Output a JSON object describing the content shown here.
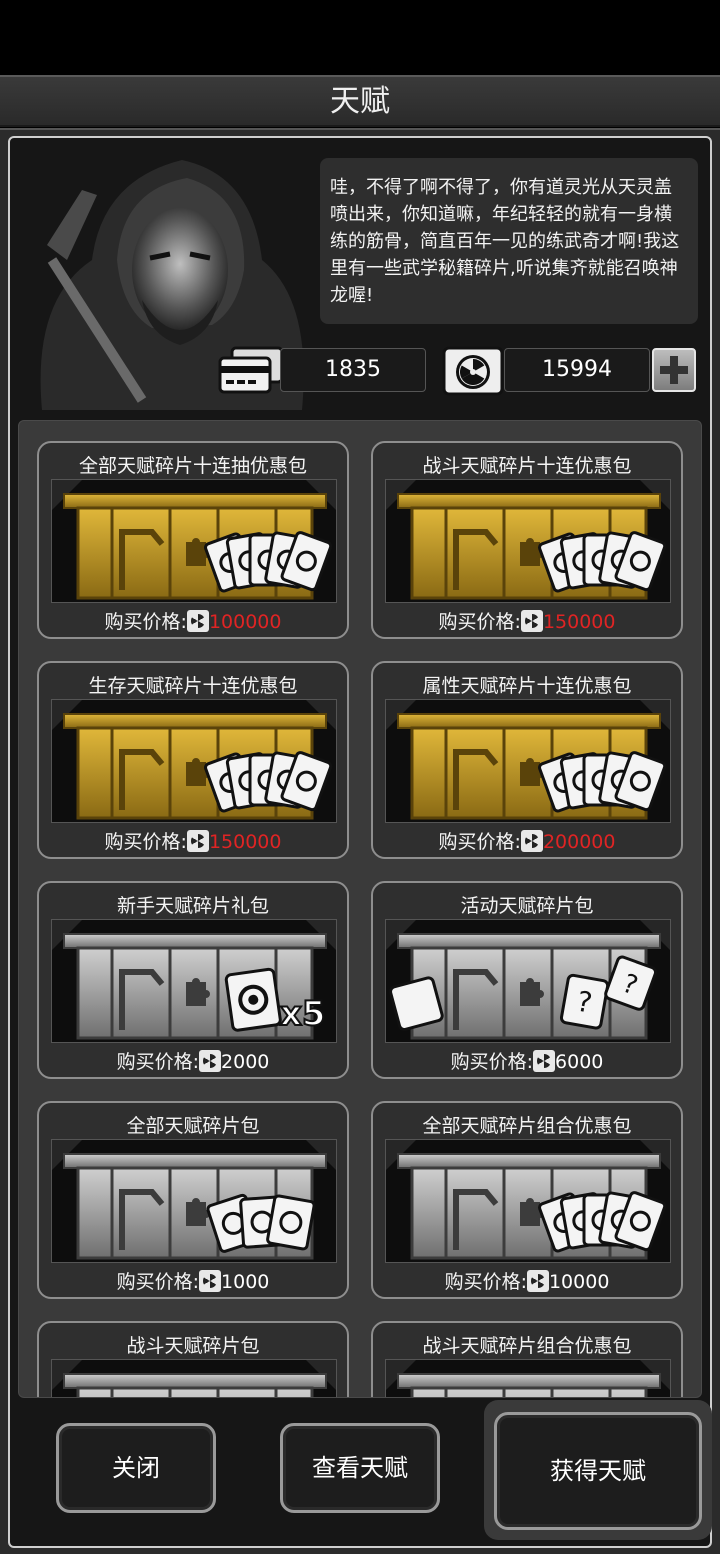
{
  "header": {
    "title": "天赋"
  },
  "npc": {
    "dialogue": "哇，不得了啊不得了，你有道灵光从天灵盖喷出来，你知道嘛，年纪轻轻的就有一身横练的筋骨，简直百年一见的练武奇才啊!我这里有一些武学秘籍碎片,听说集齐就能召唤神龙喔!"
  },
  "currencies": [
    {
      "icon": "card-ticket-icon",
      "value": "1835"
    },
    {
      "icon": "radiation-token-icon",
      "value": "15994"
    }
  ],
  "price_label": "购买价格:",
  "packs": [
    {
      "name": "全部天赋碎片十连抽优惠包",
      "price": "100000",
      "tier": "gold",
      "price_color": "#e02424",
      "badge": "cards"
    },
    {
      "name": "战斗天赋碎片十连优惠包",
      "price": "150000",
      "tier": "gold",
      "price_color": "#e02424",
      "badge": "cards"
    },
    {
      "name": "生存天赋碎片十连优惠包",
      "price": "150000",
      "tier": "gold",
      "price_color": "#e02424",
      "badge": "cards"
    },
    {
      "name": "属性天赋碎片十连优惠包",
      "price": "200000",
      "tier": "gold",
      "price_color": "#e02424",
      "badge": "cards"
    },
    {
      "name": "新手天赋碎片礼包",
      "price": "2000",
      "tier": "silver",
      "price_color": "#ffffff",
      "badge": "x5"
    },
    {
      "name": "活动天赋碎片包",
      "price": "6000",
      "tier": "silver",
      "price_color": "#ffffff",
      "badge": "pieces"
    },
    {
      "name": "全部天赋碎片包",
      "price": "1000",
      "tier": "silver",
      "price_color": "#ffffff",
      "badge": "few"
    },
    {
      "name": "全部天赋碎片组合优惠包",
      "price": "10000",
      "tier": "silver",
      "price_color": "#ffffff",
      "badge": "cards"
    },
    {
      "name": "战斗天赋碎片包",
      "price": "",
      "tier": "silver",
      "price_color": "#ffffff",
      "badge": "none"
    },
    {
      "name": "战斗天赋碎片组合优惠包",
      "price": "",
      "tier": "silver",
      "price_color": "#ffffff",
      "badge": "none"
    }
  ],
  "badge_x5_label": "x5",
  "buttons": {
    "close": "关闭",
    "view": "查看天赋",
    "obtain": "获得天赋"
  }
}
